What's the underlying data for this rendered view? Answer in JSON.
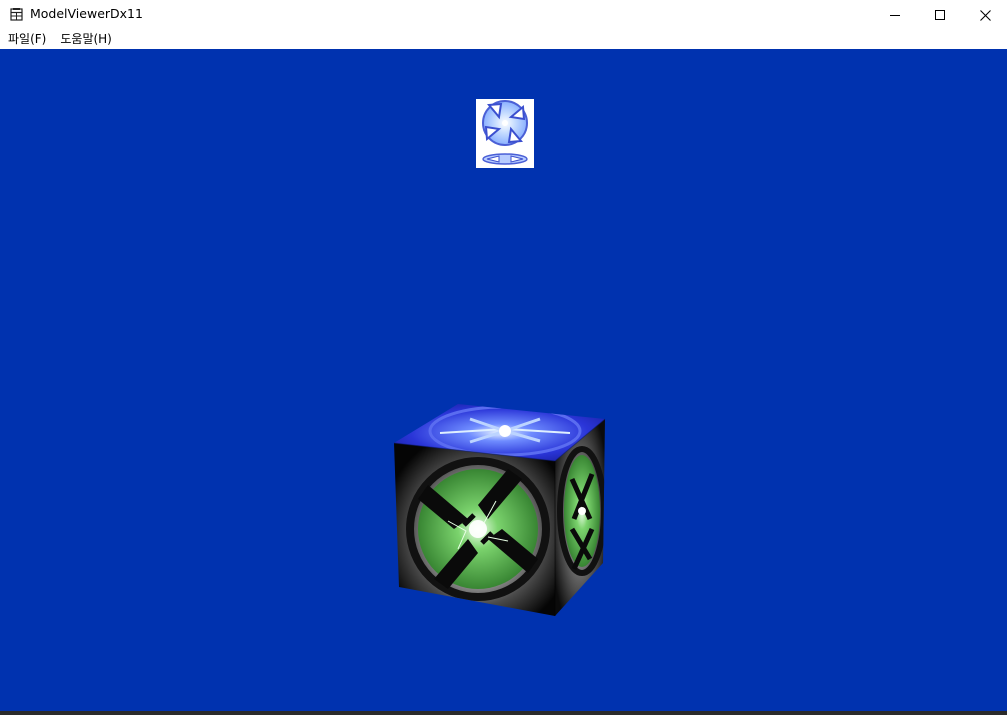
{
  "window": {
    "title": "ModelViewerDx11",
    "icon": "app-window-icon"
  },
  "caption_buttons": {
    "minimize_icon": "minimize-icon",
    "maximize_icon": "maximize-icon",
    "close_icon": "close-icon"
  },
  "menu": {
    "items": [
      {
        "label": "파일(F)"
      },
      {
        "label": "도움말(H)"
      }
    ]
  },
  "viewport": {
    "background_color": "#0032af",
    "objects": [
      {
        "name": "texture-preview",
        "icon": "x-emblem-texture"
      },
      {
        "name": "textured-cube",
        "icon": "x-emblem-cube"
      }
    ]
  }
}
